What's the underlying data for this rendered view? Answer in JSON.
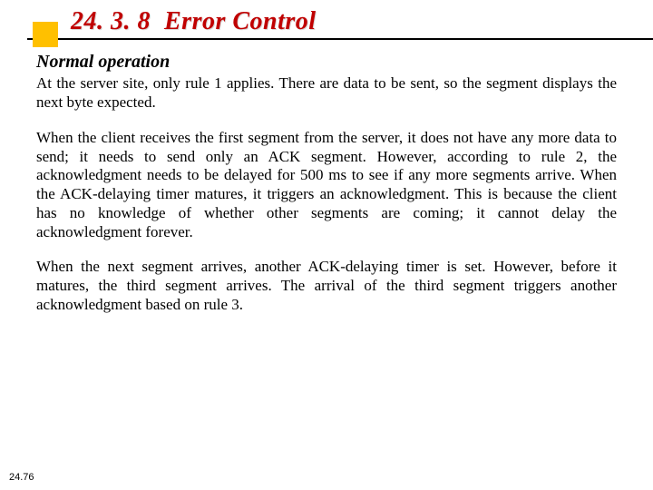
{
  "header": {
    "section_number": "24. 3. 8",
    "title": "Error Control"
  },
  "subtitle": "Normal operation",
  "paragraphs": {
    "p1": "At the server site, only rule 1 applies. There are data to be sent, so the segment displays the next byte expected.",
    "p2": "When the client receives the first segment from the server, it does not have any more data to send; it needs to send only an ACK segment. However, according to rule 2, the acknowledgment needs to be delayed for 500 ms to see if any more segments arrive. When the ACK-delaying timer matures, it triggers an acknowledgment. This is because the client has no knowledge of whether other segments are coming; it cannot delay the acknowledgment forever.",
    "p3": "When the next segment arrives, another ACK-delaying timer is set. However, before it matures, the third segment arrives. The arrival of the third segment triggers another acknowledgment based on rule 3."
  },
  "slide_number": "24.76"
}
